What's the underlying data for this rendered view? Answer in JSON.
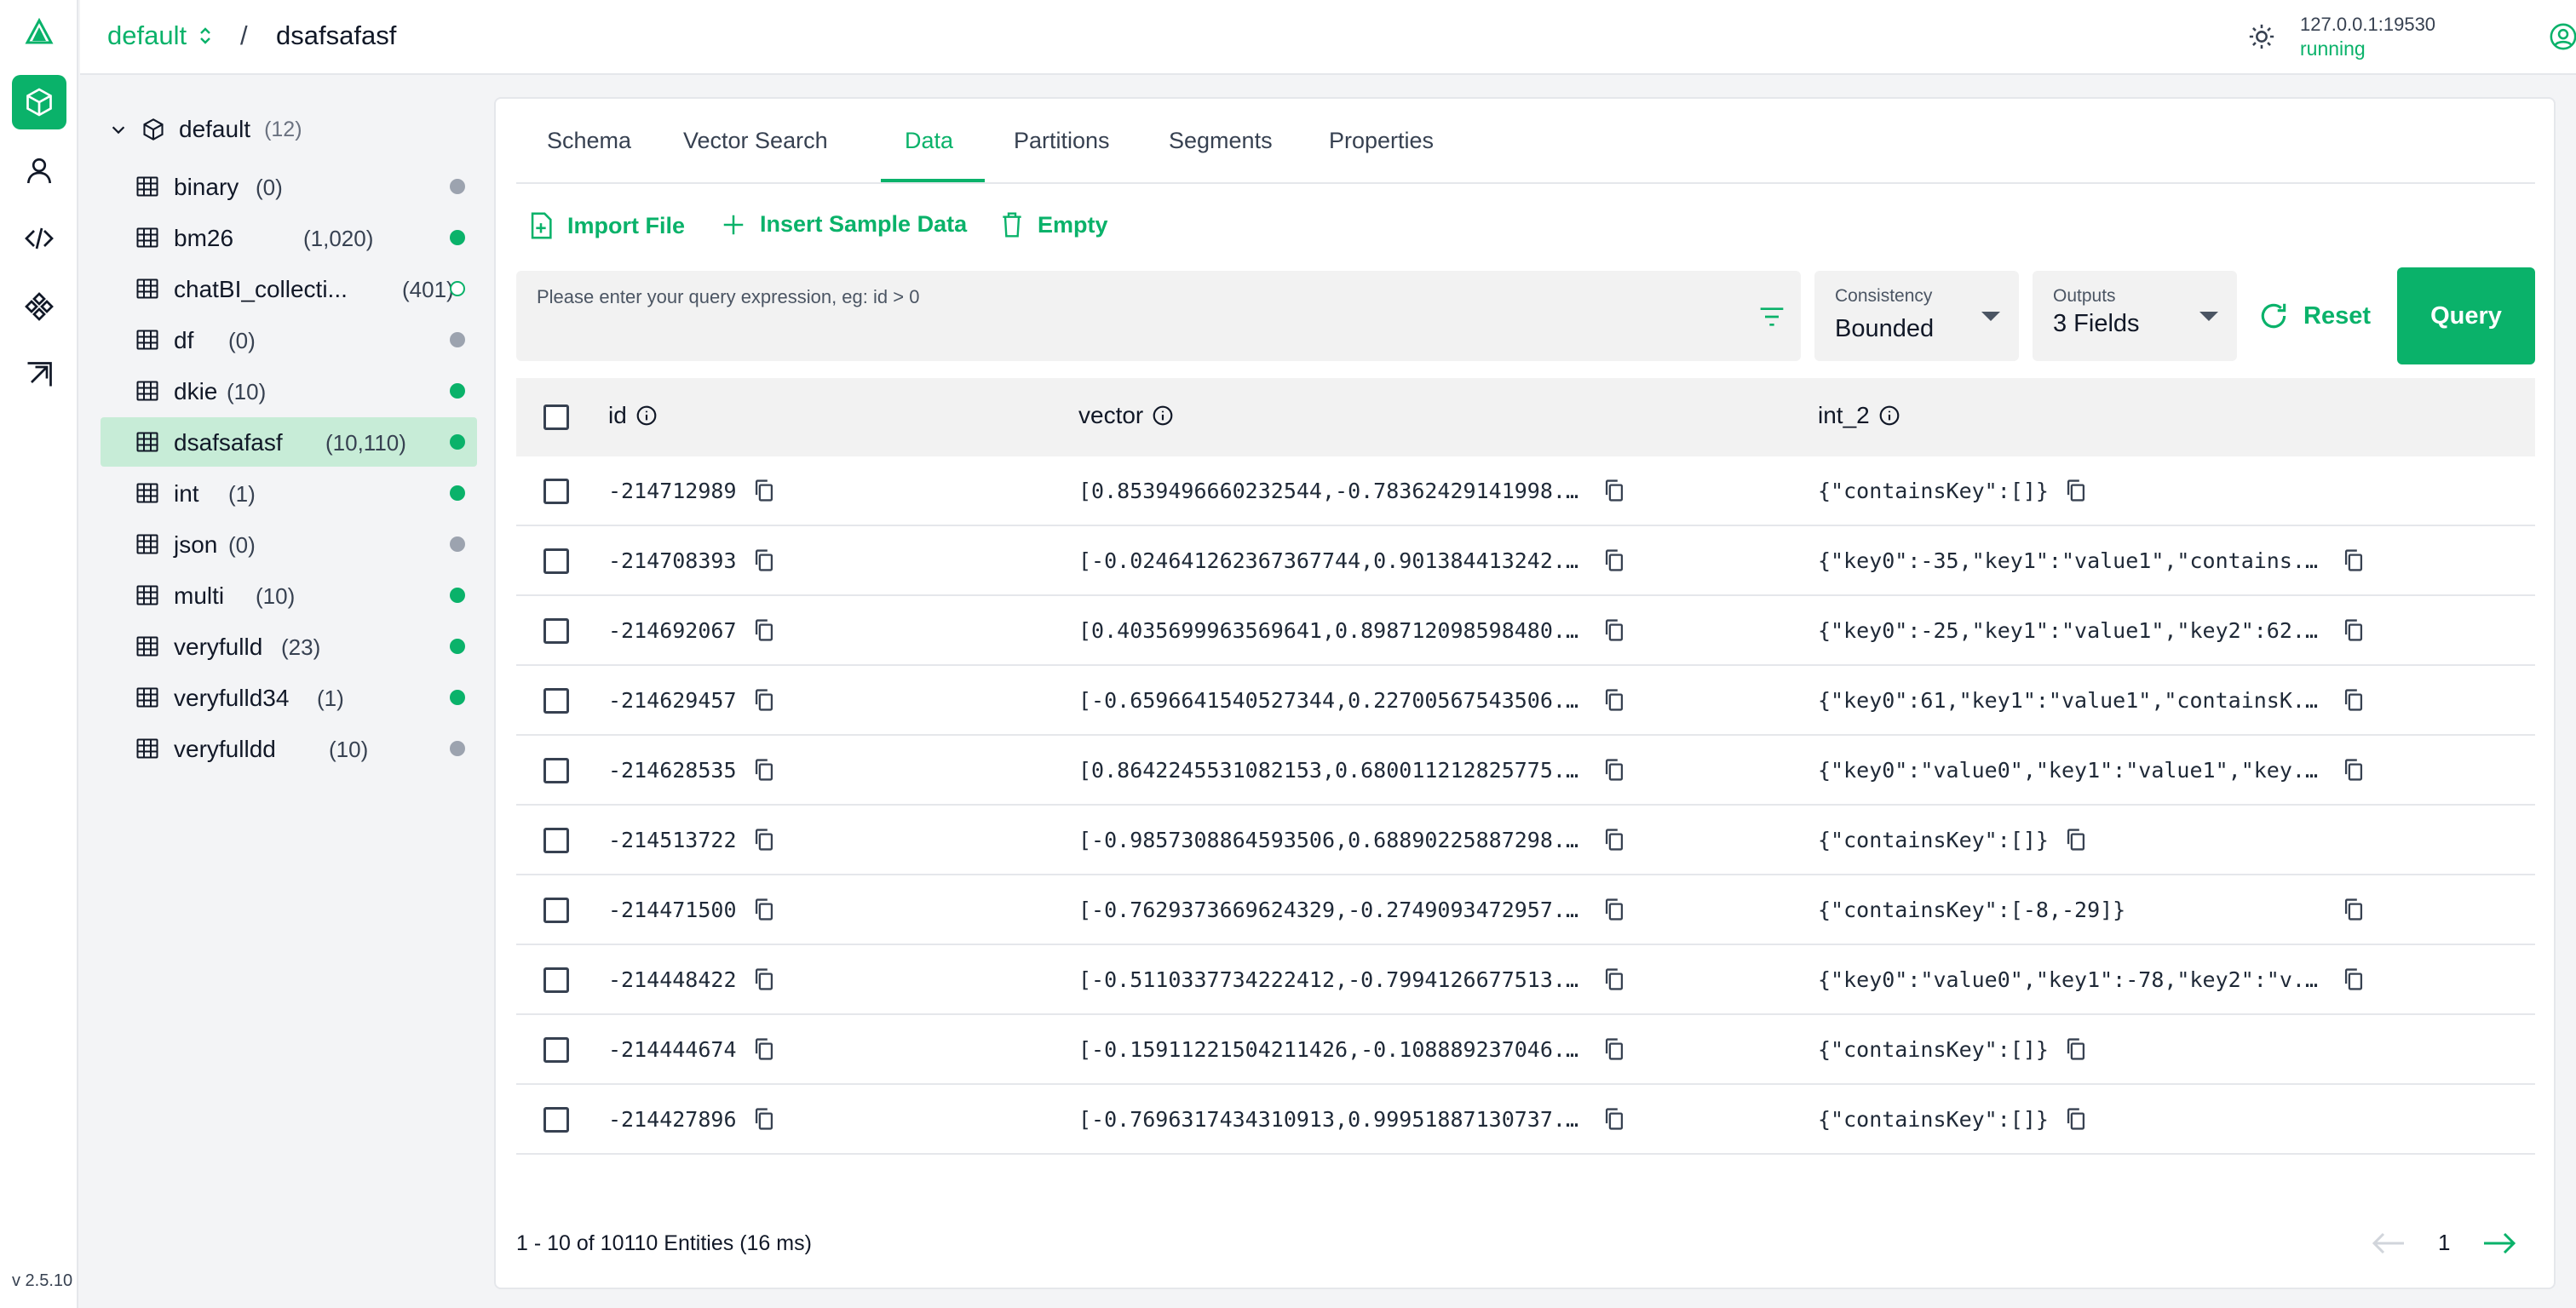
{
  "app": {
    "version": "v 2.5.10",
    "server_address": "127.0.0.1:19530",
    "server_status": "running",
    "accent_color": "#0ab26a"
  },
  "breadcrumb": {
    "database": "default",
    "separator": "/",
    "collection": "dsafsafasf"
  },
  "tree": {
    "root": {
      "label": "default",
      "count": "(12)"
    },
    "items": [
      {
        "label": "binary",
        "count": "(0)",
        "status": "gray"
      },
      {
        "label": "bm26",
        "count": "(1,020)",
        "status": "green"
      },
      {
        "label": "chatBI_collecti...",
        "count": "(401)",
        "status": "hollow"
      },
      {
        "label": "df",
        "count": "(0)",
        "status": "gray"
      },
      {
        "label": "dkie",
        "count": "(10)",
        "status": "green"
      },
      {
        "label": "dsafsafasf",
        "count": "(10,110)",
        "status": "green",
        "active": true
      },
      {
        "label": "int",
        "count": "(1)",
        "status": "green"
      },
      {
        "label": "json",
        "count": "(0)",
        "status": "gray"
      },
      {
        "label": "multi",
        "count": "(10)",
        "status": "green"
      },
      {
        "label": "veryfulld",
        "count": "(23)",
        "status": "green"
      },
      {
        "label": "veryfulld34",
        "count": "(1)",
        "status": "green"
      },
      {
        "label": "veryfulldd",
        "count": "(10)",
        "status": "gray"
      }
    ]
  },
  "tabs": [
    {
      "label": "Schema"
    },
    {
      "label": "Vector Search"
    },
    {
      "label": "Data",
      "active": true
    },
    {
      "label": "Partitions"
    },
    {
      "label": "Segments"
    },
    {
      "label": "Properties"
    }
  ],
  "actions": {
    "import": "Import File",
    "insert": "Insert Sample Data",
    "empty": "Empty"
  },
  "query": {
    "placeholder": "Please enter your query expression, eg: id > 0",
    "consistency_label": "Consistency",
    "consistency_value": "Bounded",
    "outputs_label": "Outputs",
    "outputs_value": "3 Fields",
    "reset": "Reset",
    "query": "Query"
  },
  "table": {
    "columns": [
      "id",
      "vector",
      "int_2"
    ],
    "rows": [
      {
        "id": "-214712989",
        "vector": "[0.8539496660232544,-0.78362429141998...",
        "int_2": "{\"containsKey\":[]}"
      },
      {
        "id": "-214708393",
        "vector": "[-0.024641262367367744,0.901384413242...",
        "int_2": "{\"key0\":-35,\"key1\":\"value1\",\"contains..."
      },
      {
        "id": "-214692067",
        "vector": "[0.4035699963569641,0.898712098598480...",
        "int_2": "{\"key0\":-25,\"key1\":\"value1\",\"key2\":62..."
      },
      {
        "id": "-214629457",
        "vector": "[-0.6596641540527344,0.22700567543506...",
        "int_2": "{\"key0\":61,\"key1\":\"value1\",\"containsK..."
      },
      {
        "id": "-214628535",
        "vector": "[0.8642245531082153,0.680011212825775...",
        "int_2": "{\"key0\":\"value0\",\"key1\":\"value1\",\"key..."
      },
      {
        "id": "-214513722",
        "vector": "[-0.9857308864593506,0.68890225887298...",
        "int_2": "{\"containsKey\":[]}"
      },
      {
        "id": "-214471500",
        "vector": "[-0.7629373669624329,-0.2749093472957...",
        "int_2": "{\"containsKey\":[-8,-29]}"
      },
      {
        "id": "-214448422",
        "vector": "[-0.5110337734222412,-0.7994126677513...",
        "int_2": "{\"key0\":\"value0\",\"key1\":-78,\"key2\":\"v..."
      },
      {
        "id": "-214444674",
        "vector": "[-0.15911221504211426,-0.108889237046...",
        "int_2": "{\"containsKey\":[]}"
      },
      {
        "id": "-214427896",
        "vector": "[-0.7696317434310913,0.99951887130737...",
        "int_2": "{\"containsKey\":[]}"
      }
    ]
  },
  "footer": {
    "summary": "1 - 10 of 10110 Entities (16 ms)",
    "page": "1"
  }
}
